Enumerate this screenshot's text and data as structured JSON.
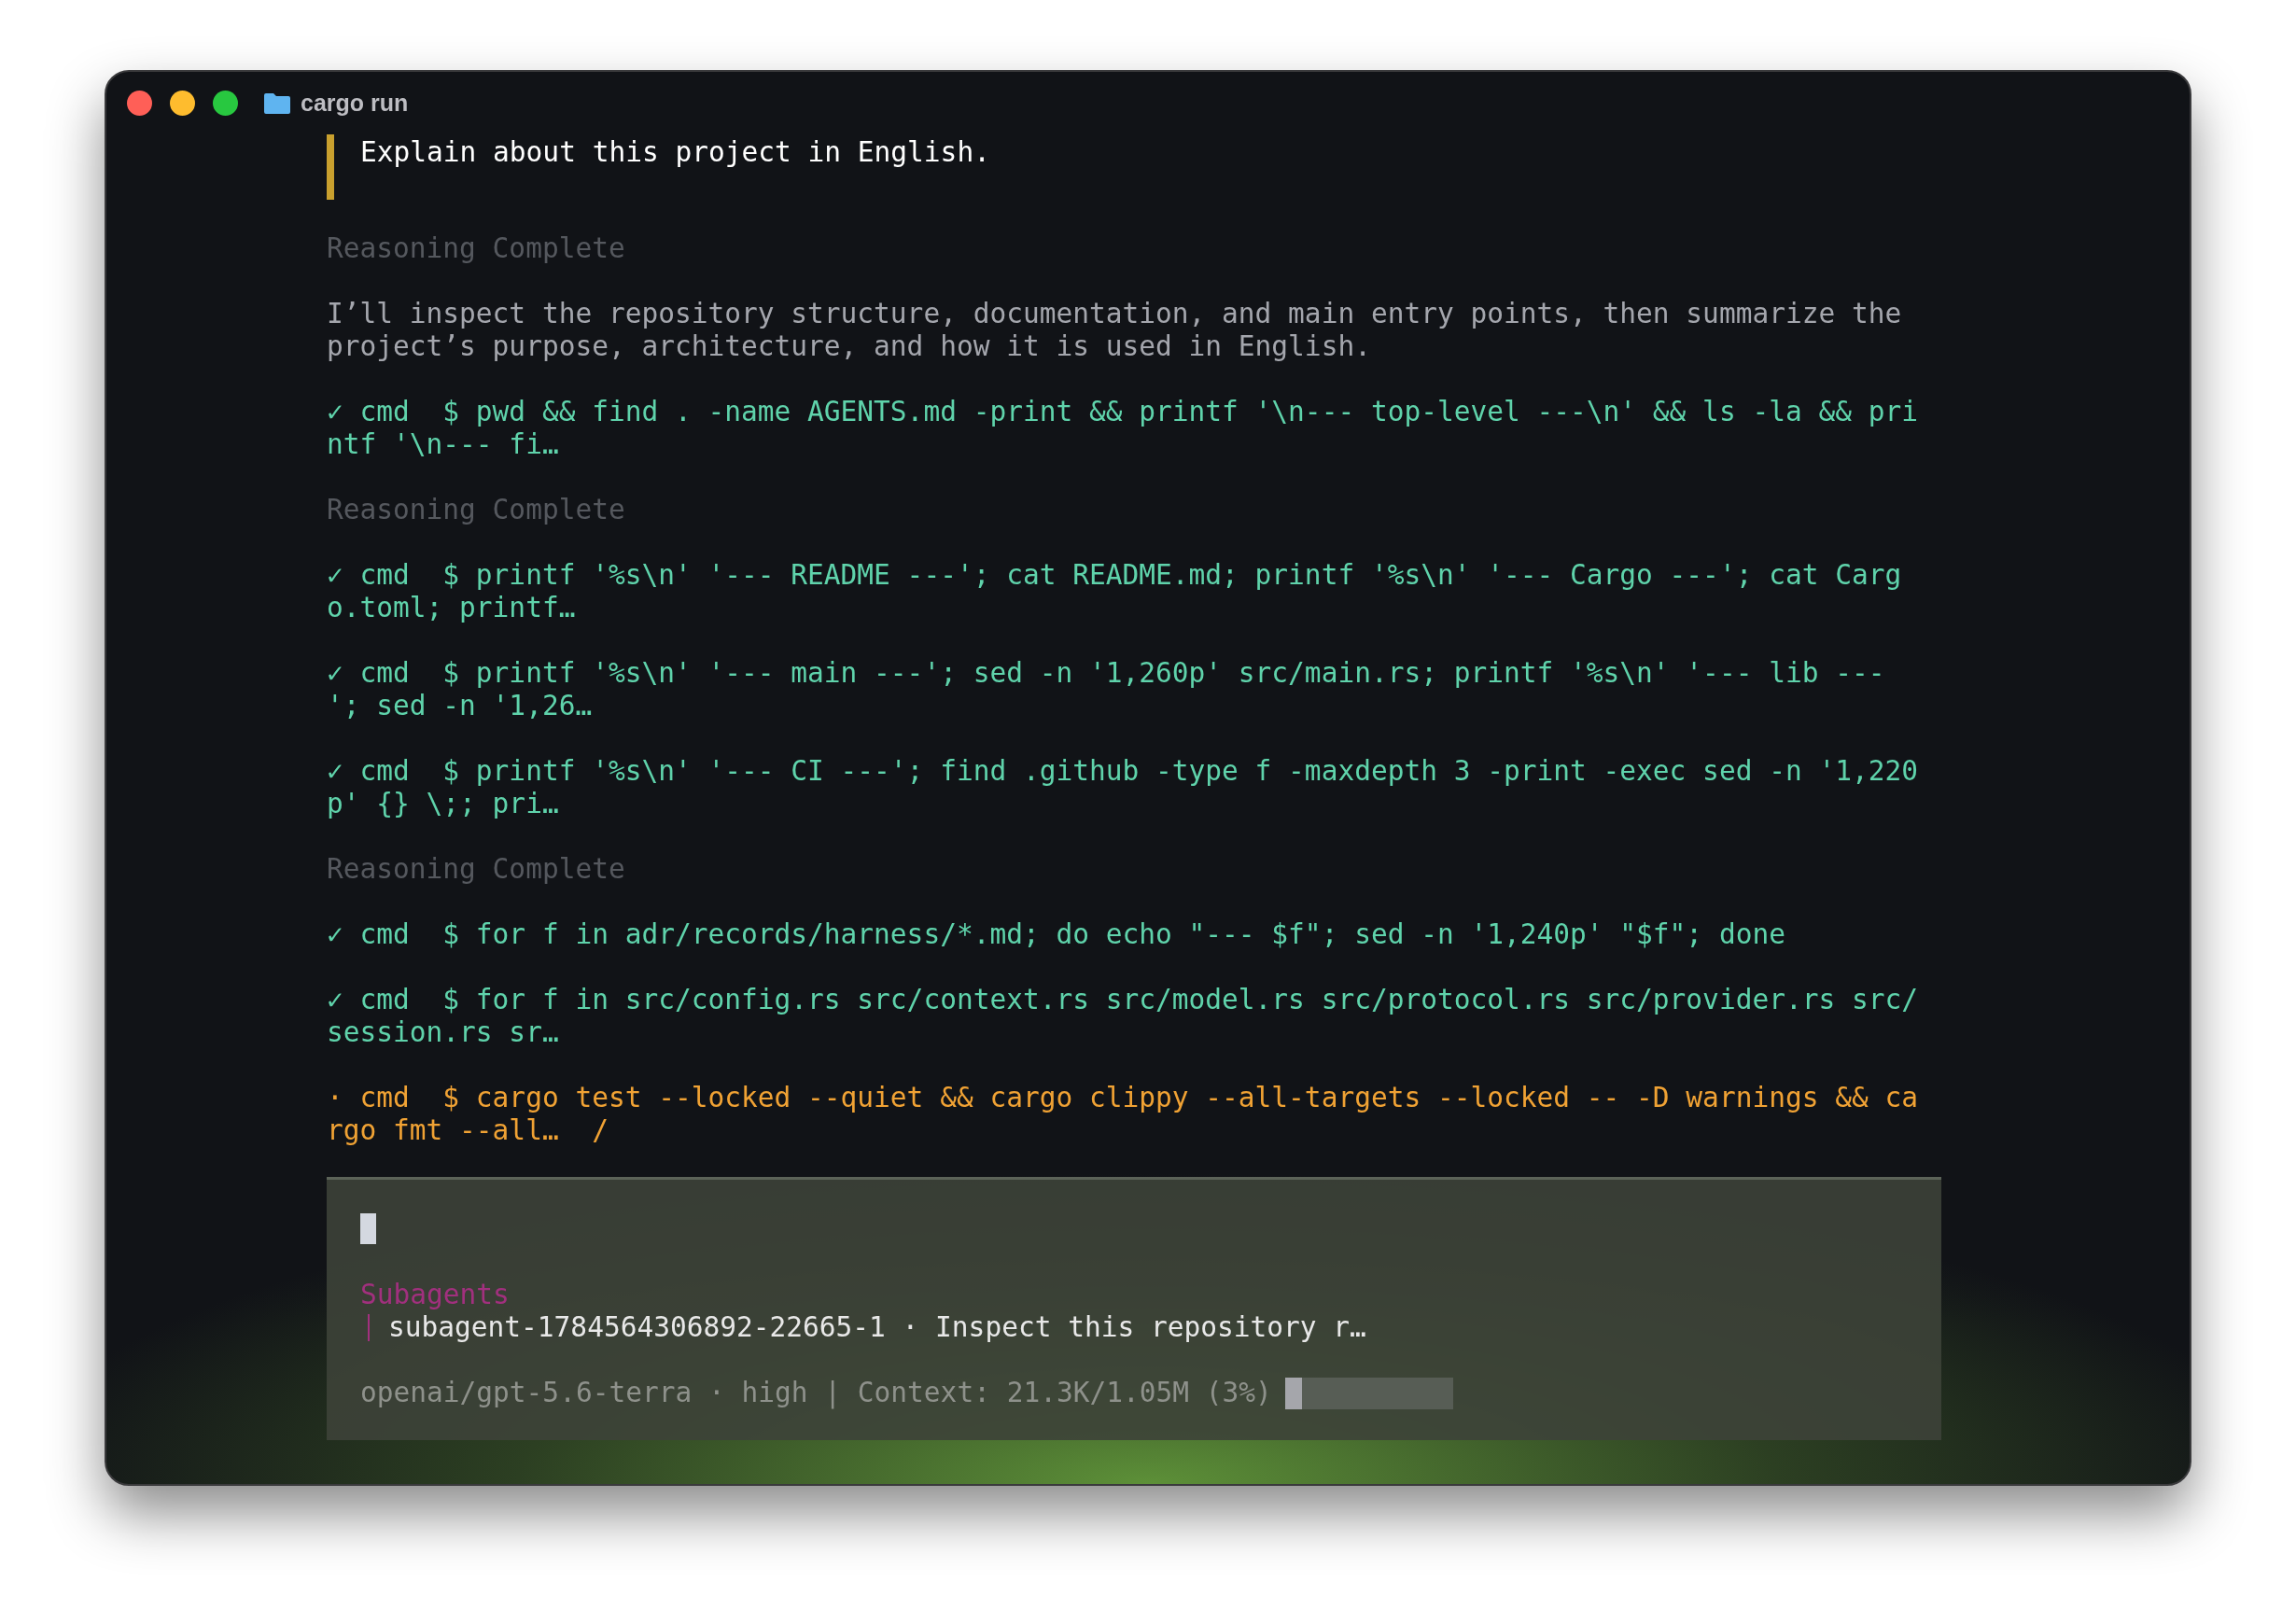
{
  "window": {
    "title": "cargo run"
  },
  "prompt": {
    "text": "Explain about this project in English."
  },
  "transcript": [
    {
      "kind": "reasoning",
      "text": "Reasoning Complete"
    },
    {
      "kind": "message",
      "text": "I’ll inspect the repository structure, documentation, and main entry points, then summarize the project’s purpose, architecture, and how it is used in English."
    },
    {
      "kind": "command",
      "running": false,
      "text": "✓ cmd  $ pwd && find . -name AGENTS.md -print && printf '\\n--- top-level ---\\n' && ls -la && printf '\\n--- fi…"
    },
    {
      "kind": "reasoning",
      "text": "Reasoning Complete"
    },
    {
      "kind": "command",
      "running": false,
      "text": "✓ cmd  $ printf '%s\\n' '--- README ---'; cat README.md; printf '%s\\n' '--- Cargo ---'; cat Cargo.toml; printf…"
    },
    {
      "kind": "command",
      "running": false,
      "text": "✓ cmd  $ printf '%s\\n' '--- main ---'; sed -n '1,260p' src/main.rs; printf '%s\\n' '--- lib ---'; sed -n '1,26…"
    },
    {
      "kind": "command",
      "running": false,
      "text": "✓ cmd  $ printf '%s\\n' '--- CI ---'; find .github -type f -maxdepth 3 -print -exec sed -n '1,220p' {} \\;; pri…"
    },
    {
      "kind": "reasoning",
      "text": "Reasoning Complete"
    },
    {
      "kind": "command",
      "running": false,
      "text": "✓ cmd  $ for f in adr/records/harness/*.md; do echo \"--- $f\"; sed -n '1,240p' \"$f\"; done"
    },
    {
      "kind": "command",
      "running": false,
      "text": "✓ cmd  $ for f in src/config.rs src/context.rs src/model.rs src/protocol.rs src/provider.rs src/session.rs sr…"
    },
    {
      "kind": "command",
      "running": true,
      "text": "· cmd  $ cargo test --locked --quiet && cargo clippy --all-targets --locked -- -D warnings && cargo fmt --all…  /"
    }
  ],
  "subagents": {
    "title": "Subagents",
    "items": [
      {
        "text": "subagent-1784564306892-22665-1 · Inspect this repository r…"
      }
    ]
  },
  "status_bar": {
    "text": "openai/gpt-5.6-terra · high | Context: 21.3K/1.05M (3%)",
    "level": 0.1
  }
}
